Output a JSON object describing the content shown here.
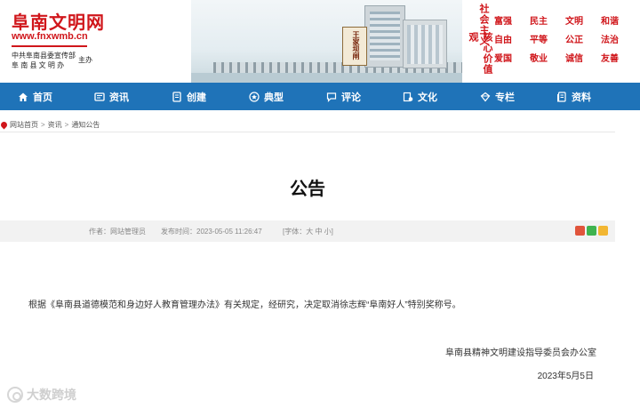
{
  "header": {
    "site_name": "阜南文明网",
    "site_url": "www.fnxwmb.cn",
    "sponsor_line1": "中共阜南县委宣传部",
    "sponsor_line2": "阜 南 县 文 明 办",
    "sponsor_suffix": "主办",
    "gate_sign": "王家坝闸",
    "core_values_heading_a": "社会主义",
    "core_values_heading_b": "核心价值观",
    "core_values": [
      "富强",
      "民主",
      "文明",
      "和谐",
      "自由",
      "平等",
      "公正",
      "法治",
      "爱国",
      "敬业",
      "诚信",
      "友善"
    ]
  },
  "nav": {
    "items": [
      {
        "label": "首页",
        "icon": "home-icon"
      },
      {
        "label": "资讯",
        "icon": "news-icon"
      },
      {
        "label": "创建",
        "icon": "document-icon"
      },
      {
        "label": "典型",
        "icon": "star-icon"
      },
      {
        "label": "评论",
        "icon": "comment-icon"
      },
      {
        "label": "文化",
        "icon": "culture-icon"
      },
      {
        "label": "专栏",
        "icon": "column-icon"
      },
      {
        "label": "资料",
        "icon": "archive-icon"
      }
    ],
    "color": "#1f73b8"
  },
  "breadcrumb": {
    "items": [
      "网站首页",
      "资讯",
      "通知公告"
    ],
    "separator": ">"
  },
  "article": {
    "title": "公告",
    "author_label": "作者：网站管理员",
    "time_label": "发布时间：2023-05-05 11:26:47",
    "font_size_label": "[字体：大 中 小]",
    "body": "根据《阜南县道德模范和身边好人教育管理办法》有关规定，经研究，决定取消徐志辉“阜南好人”特别奖称号。",
    "signature": "阜南县精神文明建设指导委员会办公室",
    "date": "2023年5月5日"
  },
  "watermark": "大数跨境",
  "accent_color": "#d0161b"
}
